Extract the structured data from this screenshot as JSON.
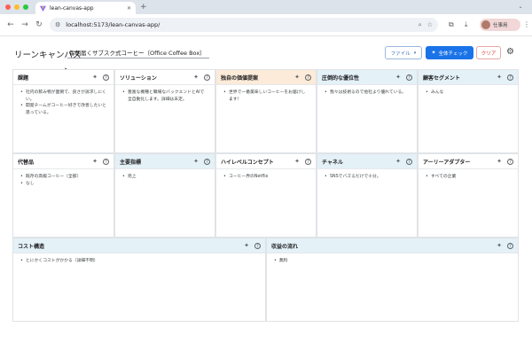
{
  "browser": {
    "tab_title": "lean-canvas-app",
    "new_tab": "+",
    "url": "localhost:5173/lean-canvas-app/",
    "profile_name": "仕事用"
  },
  "app": {
    "title": "リーンキャンバス",
    "product_name": "毎朝届くサブスク式コーヒー（Office Coffee Box） - ツ",
    "file_button": "ファイル",
    "check_button": "全体チェック",
    "clear_button": "クリア"
  },
  "cells": {
    "problem": {
      "title": "課題",
      "items": [
        "社内の飲み物が面倒で、良さが訴求しにくい。",
        "開発チームがコーヒー好きで改善したいと思っている。"
      ]
    },
    "solution": {
      "title": "ソリューション",
      "items": [
        "豊富な機種と職場なバックエンドとAIで全自動化します。詳細は未定。"
      ]
    },
    "uvp": {
      "title": "独自の価値提案",
      "items": [
        "世界で一番美味しいコーヒーをお届けします！"
      ]
    },
    "advantage": {
      "title": "圧倒的な優位性",
      "items": [
        "我々は技術るので他社より優れている。"
      ]
    },
    "segments": {
      "title": "顧客セグメント",
      "items": [
        "みんな"
      ]
    },
    "alternatives": {
      "title": "代替品",
      "items": [
        "既存の高級コーヒー（全部）",
        "なし"
      ]
    },
    "metrics": {
      "title": "主要指標",
      "items": [
        "売上"
      ]
    },
    "concept": {
      "title": "ハイレベルコンセプト",
      "items": [
        "コーヒー界のNetflix"
      ]
    },
    "channels": {
      "title": "チャネル",
      "items": [
        "SNSでバズるだけで十分。"
      ]
    },
    "early_adopters": {
      "title": "アーリーアダプター",
      "items": [
        "すべての企業"
      ]
    },
    "cost": {
      "title": "コスト構造",
      "items": [
        "とにかくコストがかかる（詳細不明）"
      ]
    },
    "revenue": {
      "title": "収益の流れ",
      "items": [
        "無料"
      ]
    }
  },
  "colors": {
    "header_plain": "#ffffff",
    "header_blue": "#e4f1f7",
    "header_orange": "#fcebd9",
    "primary": "#1a73e8",
    "danger": "#d93025"
  },
  "icons": {
    "sparkle": "sparkle-icon",
    "help": "help-icon",
    "settings": "gear-icon"
  }
}
